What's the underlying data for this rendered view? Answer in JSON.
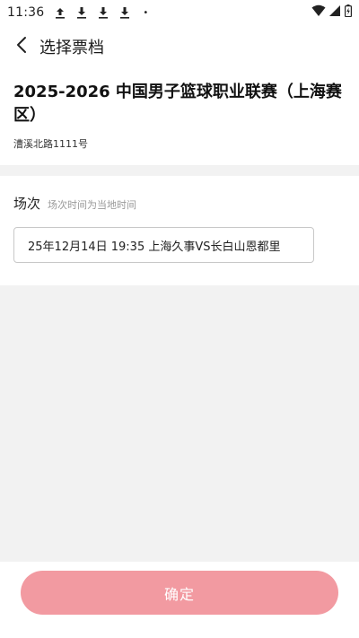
{
  "status_bar": {
    "time": "11:36",
    "icons": [
      "upload-icon",
      "download-icon",
      "download-icon",
      "download-icon"
    ],
    "dot": "•"
  },
  "header": {
    "title": "选择票档"
  },
  "event": {
    "title": "2025-2026 中国男子篮球职业联赛（上海赛区）",
    "address": "漕溪北路1111号"
  },
  "session": {
    "label": "场次",
    "hint": "场次时间为当地时间",
    "selected_option": "25年12月14日 19:35 上海久事VS长白山恩都里"
  },
  "footer": {
    "confirm_label": "确定"
  },
  "colors": {
    "confirm_button_bg": "#f29aa1",
    "page_bg": "#f2f2f2"
  }
}
